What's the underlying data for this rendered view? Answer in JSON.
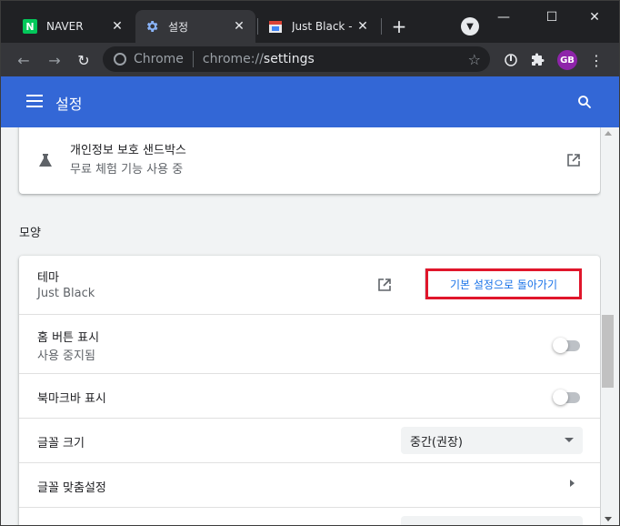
{
  "tabs": [
    {
      "title": "NAVER",
      "favicon": "N",
      "favicon_bg": "#03c75a",
      "active": false
    },
    {
      "title": "설정",
      "favicon": "gear-icon",
      "active": true
    },
    {
      "title": "Just Black - C",
      "favicon": "store-icon",
      "active": false
    }
  ],
  "toolbar": {
    "origin_label": "Chrome",
    "url_scheme": "chrome://",
    "url_path": "settings",
    "avatar_initials": "GB"
  },
  "header": {
    "title": "설정",
    "bg_color": "#3367d6"
  },
  "privacy_sandbox": {
    "title": "개인정보 보호 샌드박스",
    "subtitle": "무료 체험 기능 사용 중"
  },
  "appearance": {
    "section_title": "모양",
    "theme": {
      "label": "테마",
      "value": "Just Black",
      "reset_label": "기본 설정으로 돌아가기"
    },
    "home_button": {
      "label": "홈 버튼 표시",
      "sublabel": "사용 중지됨",
      "enabled": false
    },
    "bookmarks_bar": {
      "label": "북마크바 표시",
      "enabled": false
    },
    "font_size": {
      "label": "글꼴 크기",
      "selected": "중간(권장)"
    },
    "customize_fonts": {
      "label": "글꼴 맞춤설정"
    }
  },
  "colors": {
    "accent": "#1a73e8",
    "highlight_border": "#e0162b"
  }
}
